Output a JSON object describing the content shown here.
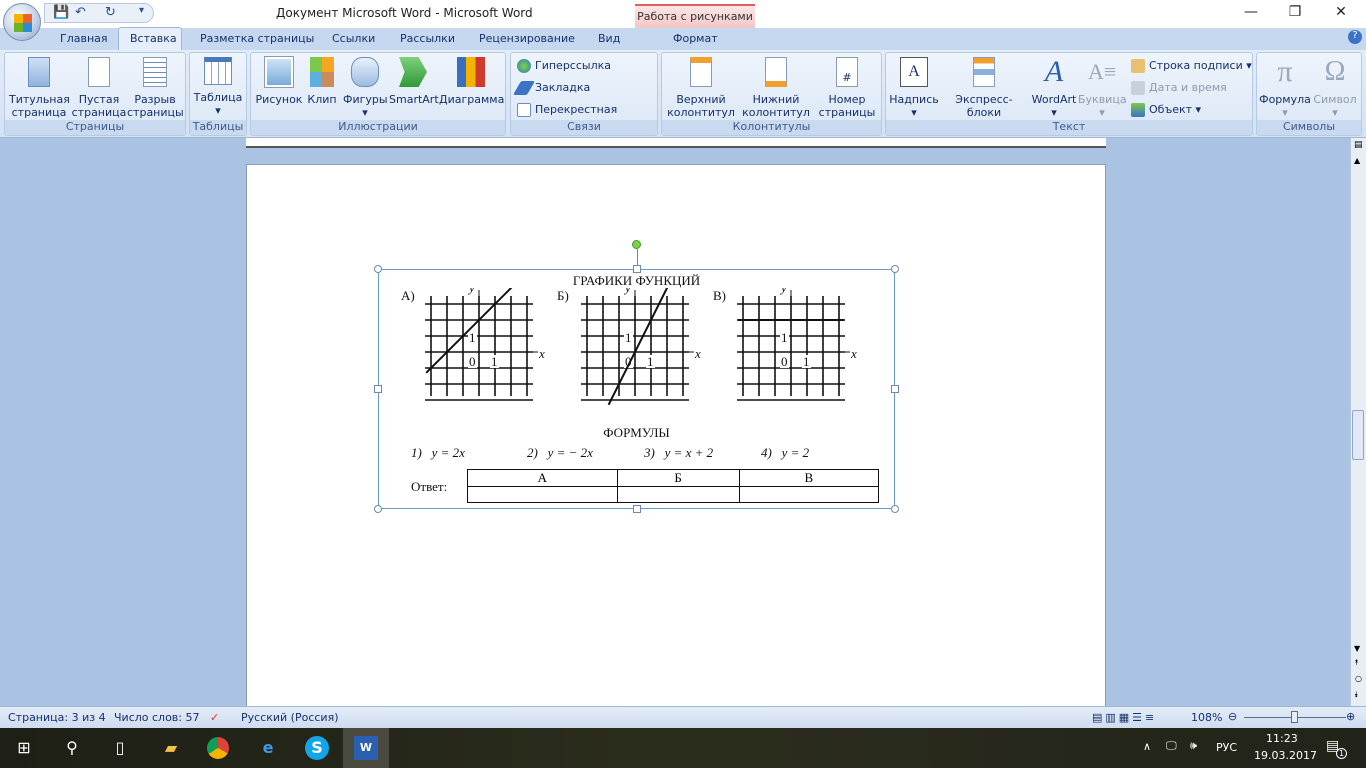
{
  "window": {
    "title": "Документ Microsoft Word - Microsoft Word",
    "context_tab": "Работа с рисунками"
  },
  "tabs": [
    "Главная",
    "Вставка",
    "Разметка страницы",
    "Ссылки",
    "Рассылки",
    "Рецензирование",
    "Вид",
    "Формат"
  ],
  "ribbon": {
    "pages": {
      "label": "Страницы",
      "b1": "Титульная",
      "b1b": "страница",
      "b2": "Пустая",
      "b2b": "страница",
      "b3": "Разрыв",
      "b3b": "страницы"
    },
    "tables": {
      "label": "Таблицы",
      "b1": "Таблица"
    },
    "illustrations": {
      "label": "Иллюстрации",
      "b1": "Рисунок",
      "b2": "Клип",
      "b3": "Фигуры",
      "b4": "SmartArt",
      "b5": "Диаграмма"
    },
    "links": {
      "label": "Связи",
      "b1": "Гиперссылка",
      "b2": "Закладка",
      "b3": "Перекрестная ссылка"
    },
    "headers": {
      "label": "Колонтитулы",
      "b1": "Верхний",
      "b1b": "колонтитул",
      "b2": "Нижний",
      "b2b": "колонтитул",
      "b3": "Номер",
      "b3b": "страницы"
    },
    "text": {
      "label": "Текст",
      "b1": "Надпись",
      "b2": "Экспресс-блоки",
      "b3": "WordArt",
      "b4": "Буквица",
      "s1": "Строка подписи",
      "s2": "Дата и время",
      "s3": "Объект"
    },
    "symbols": {
      "label": "Символы",
      "b1": "Формула",
      "b2": "Символ"
    }
  },
  "doc": {
    "title": "ГРАФИКИ ФУНКЦИЙ",
    "graphs": [
      {
        "label": "А)",
        "type": "line",
        "slope": 1,
        "intercept": 2
      },
      {
        "label": "Б)",
        "type": "line",
        "slope": 2,
        "intercept": 0
      },
      {
        "label": "В)",
        "type": "line",
        "slope": 0,
        "intercept": 2
      }
    ],
    "axis": {
      "x": "x",
      "y": "y",
      "zero": "0",
      "one": "1"
    },
    "formulas_title": "ФОРМУЛЫ",
    "formulas": [
      "1)   y = 2x",
      "2)   y = − 2x",
      "3)   y = x + 2",
      "4)   y = 2"
    ],
    "answer_label": "Ответ:",
    "answer_headers": [
      "А",
      "Б",
      "В"
    ]
  },
  "status": {
    "page": "Страница: 3 из 4",
    "words": "Число слов: 57",
    "lang": "Русский (Россия)",
    "zoom": "108%",
    "zoom_level": 108
  },
  "tray": {
    "lang": "РУС",
    "time": "11:23",
    "date": "19.03.2017",
    "notifications": "1"
  }
}
